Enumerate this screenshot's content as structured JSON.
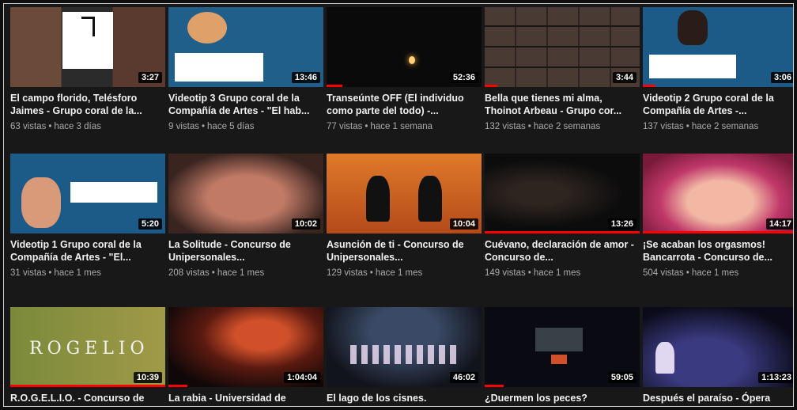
{
  "videos": [
    {
      "title": "El campo florido, Telésforo Jaimes - Grupo coral de la...",
      "views": "63 vistas",
      "age": "hace 3 días",
      "duration": "3:27",
      "progress": 0,
      "art": "a1"
    },
    {
      "title": "Videotip 3 Grupo coral de la Compañía de Artes - \"El hab...",
      "views": "9 vistas",
      "age": "hace 5 días",
      "duration": "13:46",
      "progress": 0,
      "art": "a2"
    },
    {
      "title": "Transeúnte OFF (El individuo como parte del todo) -...",
      "views": "77 vistas",
      "age": "hace 1 semana",
      "duration": "52:36",
      "progress": 10,
      "art": "a3"
    },
    {
      "title": "Bella que tienes mi alma, Thoinot Arbeau - Grupo cor...",
      "views": "132 vistas",
      "age": "hace 2 semanas",
      "duration": "3:44",
      "progress": 8,
      "art": "a4"
    },
    {
      "title": "Videotip 2 Grupo coral de la Compañía de Artes -...",
      "views": "137 vistas",
      "age": "hace 2 semanas",
      "duration": "3:06",
      "progress": 8,
      "art": "a5"
    },
    {
      "title": "Videotip 1 Grupo coral de la Compañía de Artes - \"El...",
      "views": "31 vistas",
      "age": "hace 1 mes",
      "duration": "5:20",
      "progress": 0,
      "art": "a6"
    },
    {
      "title": "La Solitude - Concurso de Unipersonales...",
      "views": "208 vistas",
      "age": "hace 1 mes",
      "duration": "10:02",
      "progress": 0,
      "art": "a7"
    },
    {
      "title": "Asunción de ti - Concurso de Unipersonales...",
      "views": "129 vistas",
      "age": "hace 1 mes",
      "duration": "10:04",
      "progress": 0,
      "art": "a8"
    },
    {
      "title": "Cuévano, declaración de amor - Concurso de...",
      "views": "149 vistas",
      "age": "hace 1 mes",
      "duration": "13:26",
      "progress": 100,
      "art": "a9"
    },
    {
      "title": "¡Se acaban los orgasmos! Bancarrota - Concurso de...",
      "views": "504 vistas",
      "age": "hace 1 mes",
      "duration": "14:17",
      "progress": 100,
      "art": "a10"
    },
    {
      "title": "R.O.G.E.L.I.O. - Concurso de",
      "views": "",
      "age": "",
      "duration": "10:39",
      "progress": 100,
      "art": "a11",
      "thumb_text": "ROGELIO"
    },
    {
      "title": "La rabia - Universidad de",
      "views": "",
      "age": "",
      "duration": "1:04:04",
      "progress": 12,
      "art": "a12"
    },
    {
      "title": "El lago de los cisnes.",
      "views": "",
      "age": "",
      "duration": "46:02",
      "progress": 0,
      "art": "a13"
    },
    {
      "title": "¿Duermen los peces?",
      "views": "",
      "age": "",
      "duration": "59:05",
      "progress": 12,
      "art": "a14"
    },
    {
      "title": "Después el paraíso - Ópera",
      "views": "",
      "age": "",
      "duration": "1:13:23",
      "progress": 0,
      "art": "a15"
    }
  ],
  "colors": {
    "background": "#181818",
    "progress": "#ff0000",
    "title": "#f1f1f1",
    "meta": "#aaaaaa"
  }
}
